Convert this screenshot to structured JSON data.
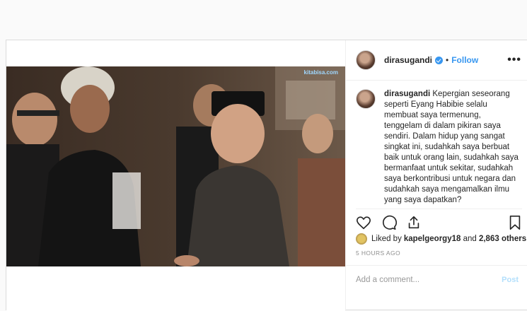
{
  "post": {
    "username": "dirasugandi",
    "follow_label": "Follow",
    "dot": "•",
    "more_label": "•••",
    "watermark": "kitabisa.com",
    "caption": {
      "username": "dirasugandi",
      "text": "Kepergian seseorang seperti Eyang Habibie selalu membuat saya termenung, tenggelam di dalam pikiran saya sendiri. Dalam hidup yang sangat singkat ini, sudahkah saya berbuat baik untuk orang lain, sudahkah saya bermanfaat untuk sekitar, sudahkah saya berkontribusi untuk negara dan sudahkah saya mengamalkan ilmu yang saya dapatkan?"
    },
    "likes": {
      "prefix": "Liked by ",
      "user": "kapelgeorgy18",
      "middle": " and ",
      "others": "2,863 others"
    },
    "time": "5 HOURS AGO",
    "comment_placeholder": "Add a comment...",
    "post_label": "Post"
  }
}
